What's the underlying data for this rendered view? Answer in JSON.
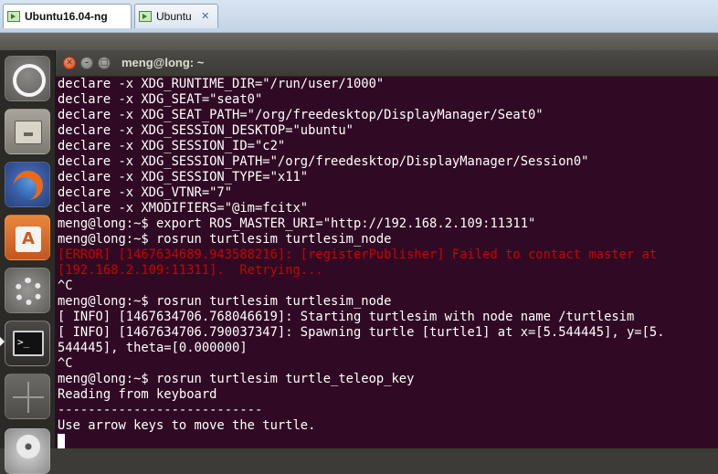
{
  "host_tabs": [
    {
      "label": "Ubuntu16.04-ng",
      "active": true,
      "icon": "vm-icon"
    },
    {
      "label": "Ubuntu",
      "active": false,
      "icon": "vm-icon"
    }
  ],
  "launcher": {
    "items": [
      {
        "name": "dash-home",
        "icon": "ubuntu-logo-icon"
      },
      {
        "name": "files",
        "icon": "file-cabinet-icon"
      },
      {
        "name": "firefox",
        "icon": "firefox-icon"
      },
      {
        "name": "software-center",
        "icon": "shopping-bag-icon"
      },
      {
        "name": "system-settings",
        "icon": "wrench-gear-icon"
      },
      {
        "name": "terminal",
        "icon": "terminal-icon"
      },
      {
        "name": "workspace-switcher",
        "icon": "workspaces-icon"
      },
      {
        "name": "disc",
        "icon": "disc-icon"
      }
    ],
    "term_prompt_glyph": ">_"
  },
  "terminal": {
    "title": "meng@long: ~",
    "lines": [
      {
        "text": "declare -x XDG_RUNTIME_DIR=\"/run/user/1000\"",
        "type": "normal"
      },
      {
        "text": "declare -x XDG_SEAT=\"seat0\"",
        "type": "normal"
      },
      {
        "text": "declare -x XDG_SEAT_PATH=\"/org/freedesktop/DisplayManager/Seat0\"",
        "type": "normal"
      },
      {
        "text": "declare -x XDG_SESSION_DESKTOP=\"ubuntu\"",
        "type": "normal"
      },
      {
        "text": "declare -x XDG_SESSION_ID=\"c2\"",
        "type": "normal"
      },
      {
        "text": "declare -x XDG_SESSION_PATH=\"/org/freedesktop/DisplayManager/Session0\"",
        "type": "normal"
      },
      {
        "text": "declare -x XDG_SESSION_TYPE=\"x11\"",
        "type": "normal"
      },
      {
        "text": "declare -x XDG_VTNR=\"7\"",
        "type": "normal"
      },
      {
        "text": "declare -x XMODIFIERS=\"@im=fcitx\"",
        "type": "normal"
      },
      {
        "text": "meng@long:~$ export ROS_MASTER_URI=\"http://192.168.2.109:11311\"",
        "type": "normal"
      },
      {
        "text": "meng@long:~$ rosrun turtlesim turtlesim_node",
        "type": "normal"
      },
      {
        "text": "[ERROR] [1467634689.943588216]: [registerPublisher] Failed to contact master at",
        "type": "err"
      },
      {
        "text": "[192.168.2.109:11311].  Retrying...",
        "type": "err"
      },
      {
        "text": "^C",
        "type": "normal"
      },
      {
        "text": "meng@long:~$ rosrun turtlesim turtlesim_node",
        "type": "normal"
      },
      {
        "text": "[ INFO] [1467634706.768046619]: Starting turtlesim with node name /turtlesim",
        "type": "normal"
      },
      {
        "text": "[ INFO] [1467634706.790037347]: Spawning turtle [turtle1] at x=[5.544445], y=[5.",
        "type": "normal"
      },
      {
        "text": "544445], theta=[0.000000]",
        "type": "normal"
      },
      {
        "text": "^C",
        "type": "normal"
      },
      {
        "text": "meng@long:~$ rosrun turtlesim turtle_teleop_key",
        "type": "normal"
      },
      {
        "text": "Reading from keyboard",
        "type": "normal"
      },
      {
        "text": "---------------------------",
        "type": "normal"
      },
      {
        "text": "Use arrow keys to move the turtle.",
        "type": "normal"
      }
    ]
  }
}
